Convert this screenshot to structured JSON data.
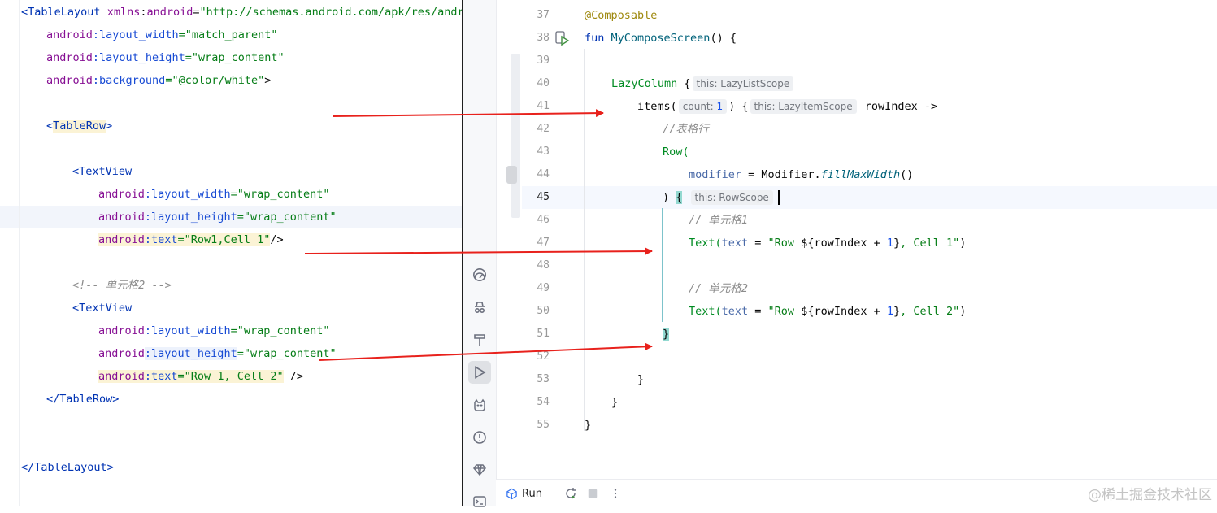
{
  "xml_editor": {
    "lines": {
      "l1_open": "<TableLayout",
      "l1_xmlns_ns": "xmlns",
      "l1_xmlns_attr": "android",
      "l1_eq": "=",
      "l1_xmlns_val": "\"http://schemas.android.com/apk/res/andro",
      "l2_ns": "android",
      "l2_attr": ":layout_width",
      "l2_val": "=\"match_parent\"",
      "l3_ns": "android",
      "l3_attr": ":layout_height",
      "l3_val": "=\"wrap_content\"",
      "l4_ns": "android",
      "l4_attr": ":background",
      "l4_val": "=\"@color/white\"",
      "l4_close": ">",
      "l6_lt": "<",
      "l6_tag": "TableRow",
      "l6_gt": ">",
      "l8_tag": "<TextView",
      "l9_ns": "android",
      "l9_attr": ":layout_width",
      "l9_val": "=\"wrap_content\"",
      "l10_ns": "android",
      "l10_attr": ":layout_height",
      "l10_val": "=\"wrap_content\"",
      "l11_ns": "android",
      "l11_attr": ":text",
      "l11_val": "=\"Row1,Cell 1\"",
      "l11_close": "/>",
      "l13_comment": "<!-- 单元格2 -->",
      "l14_tag": "<TextView",
      "l15_ns": "android",
      "l15_attr": ":layout_width",
      "l15_val": "=\"wrap_content\"",
      "l16_ns": "android",
      "l16_attr": ":layout_height",
      "l16_val": "=\"wrap_content\"",
      "l17_ns": "android",
      "l17_attr": ":text",
      "l17_val": "=\"Row 1, Cell 2\"",
      "l17_close": " />",
      "l18_tag": "</TableRow>",
      "l21_tag": "</TableLayout>"
    }
  },
  "compose_editor": {
    "line_numbers": [
      "37",
      "38",
      "39",
      "40",
      "41",
      "42",
      "43",
      "44",
      "45",
      "46",
      "47",
      "48",
      "49",
      "50",
      "51",
      "52",
      "53",
      "54",
      "55"
    ],
    "current_line": "45",
    "code": {
      "l37_annotation": "@Composable",
      "l38_kw": "fun ",
      "l38_fn": "MyComposeScreen",
      "l38_rest": "() {",
      "l40_call": "LazyColumn",
      "l40_brace": " {",
      "l40_hint": "this: LazyListScope",
      "l41_call": "items(",
      "l41_hint_count": "count:",
      "l41_count": "1",
      "l41_brace": ") {",
      "l41_hint_scope": "this: LazyItemScope",
      "l41_param": "rowIndex ->",
      "l42_comment": "//表格行",
      "l43_call": "Row(",
      "l44_param": "modifier",
      "l44_eq": " = ",
      "l44_obj": "Modifier.",
      "l44_fn": "fillMaxWidth",
      "l44_paren": "()",
      "l45_close": ") ",
      "l45_brace": "{",
      "l45_hint": "this: RowScope",
      "l46_comment": "// 单元格1",
      "l47_call": "Text(",
      "l47_param": "text",
      "l47_eq": " = ",
      "l47_str1": "\"Row ",
      "l47_tmpl_open": "${",
      "l47_var": "rowIndex + ",
      "l47_num": "1",
      "l47_tmpl_close": "}",
      "l47_str2": ", Cell 1\"",
      "l47_paren": ")",
      "l49_comment": "// 单元格2",
      "l50_call": "Text(",
      "l50_param": "text",
      "l50_eq": " = ",
      "l50_str1": "\"Row ",
      "l50_tmpl_open": "${",
      "l50_var": "rowIndex + ",
      "l50_num": "1",
      "l50_tmpl_close": "}",
      "l50_str2": ", Cell 2\"",
      "l50_paren": ")",
      "l51_brace": "}",
      "l53_brace": "}",
      "l54_brace": "}",
      "l55_brace": "}"
    }
  },
  "toolstrip": {
    "icons": [
      "gauge-icon",
      "spy-icon",
      "build-icon",
      "run-icon",
      "logcat-icon",
      "problems-icon",
      "gem-icon",
      "terminal-icon"
    ],
    "active": "run-icon"
  },
  "run_bar": {
    "label": "Run"
  },
  "watermark": "@稀土掘金技术社区",
  "colors": {
    "arrow": "#e8211c",
    "brace_highlight": "#93d9d1",
    "current_line": "#f5f8fe"
  }
}
